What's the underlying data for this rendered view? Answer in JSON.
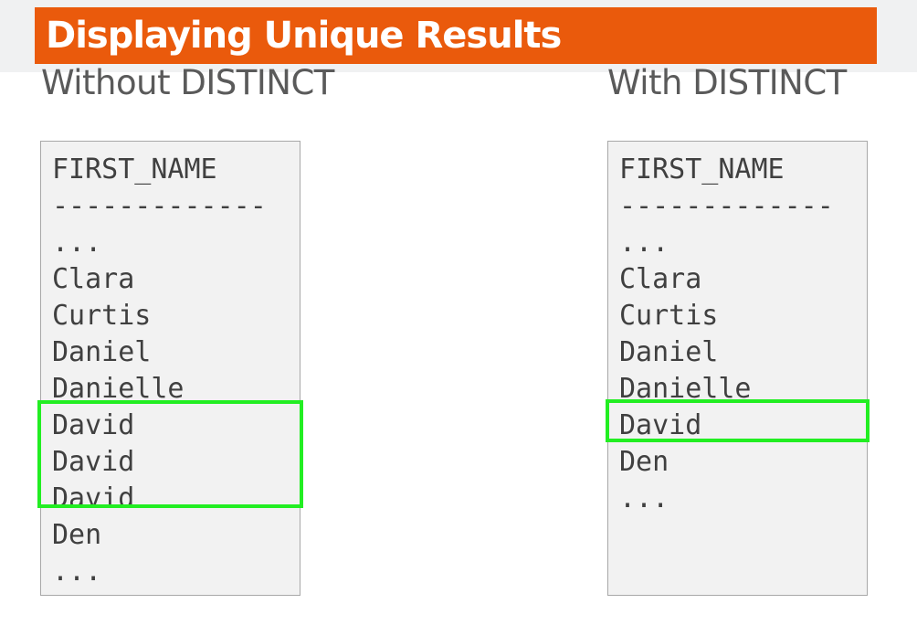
{
  "slide": {
    "title": "Displaying Unique Results",
    "accent_color": "#ea5a0c",
    "highlight_color": "#22ee22"
  },
  "left_panel": {
    "heading": "Without DISTINCT",
    "lines": [
      "FIRST_NAME",
      "-------------",
      "...",
      "Clara",
      "Curtis",
      "Daniel",
      "Danielle",
      "David",
      "David",
      "David",
      "Den",
      "..."
    ]
  },
  "right_panel": {
    "heading": "With DISTINCT",
    "lines": [
      "FIRST_NAME",
      "-------------",
      "...",
      "Clara",
      "Curtis",
      "Daniel",
      "Danielle",
      "David",
      "Den",
      "..."
    ]
  }
}
